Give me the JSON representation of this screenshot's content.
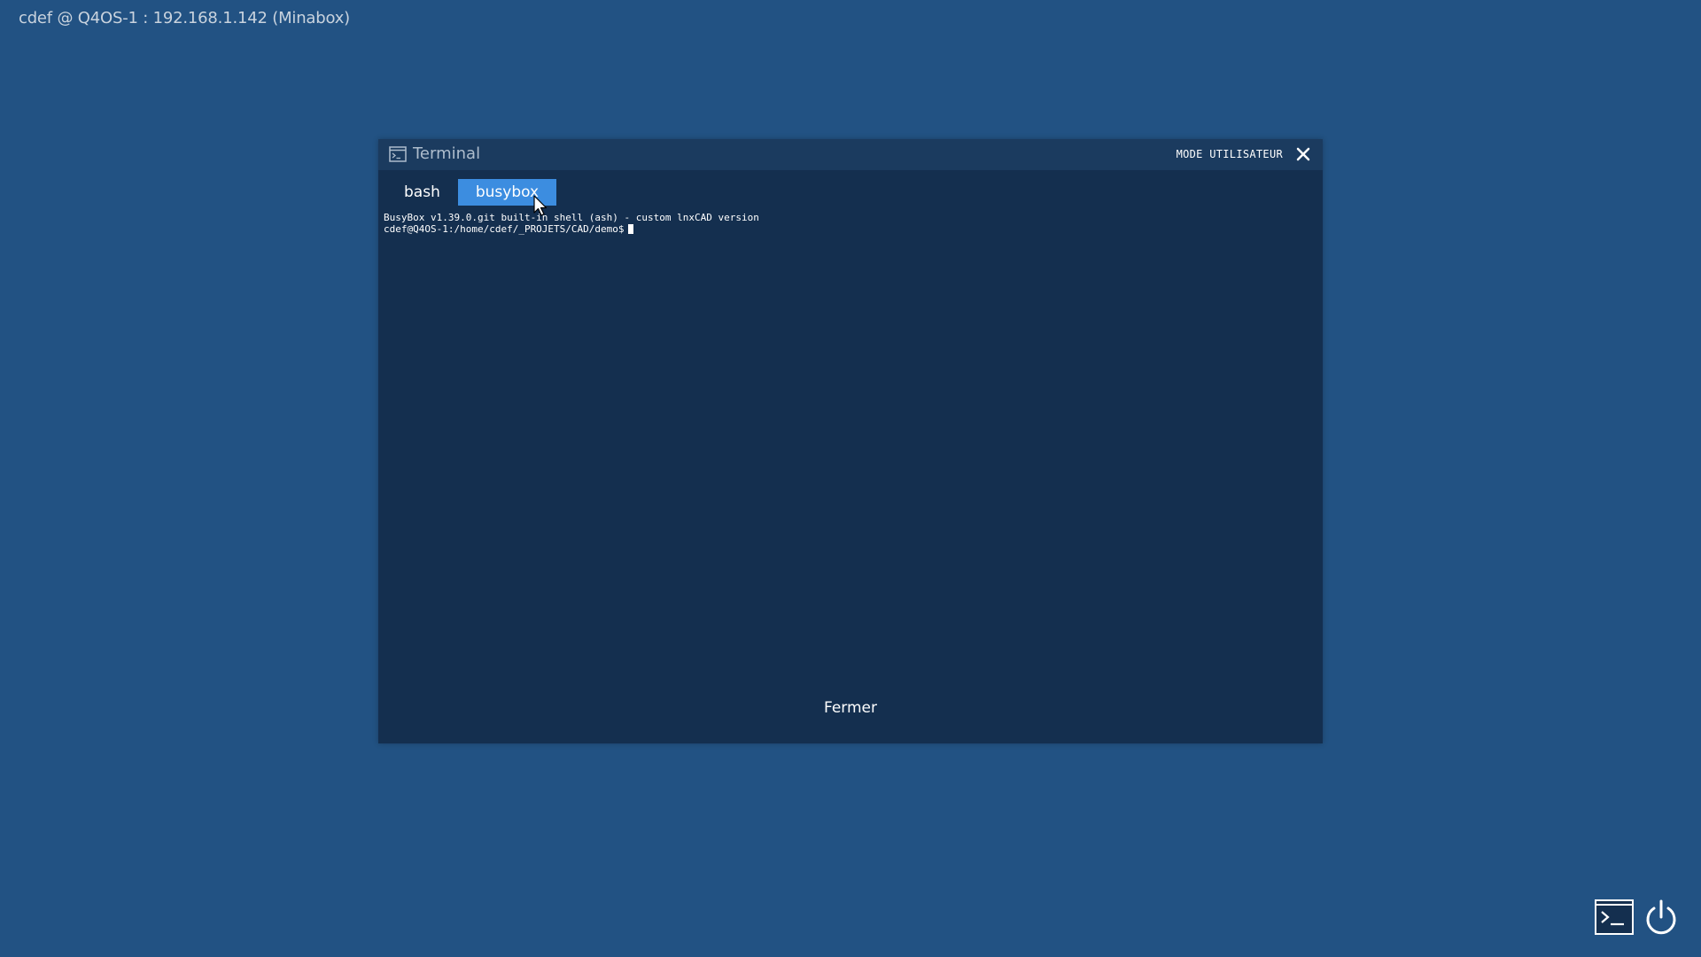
{
  "desktop": {
    "host_label": "cdef @ Q4OS-1 : 192.168.1.142 (Minabox)"
  },
  "window": {
    "title": "Terminal",
    "title_icon": "terminal-icon",
    "mode_label": "MODE UTILISATEUR",
    "close_icon": "close-icon",
    "tabs": [
      {
        "label": "bash",
        "active": false
      },
      {
        "label": "busybox",
        "active": true
      }
    ],
    "terminal_lines": [
      "BusyBox v1.39.0.git built-in shell (ash) - custom lnxCAD version",
      "cdef@Q4OS-1:/home/cdef/_PROJETS/CAD/demo$"
    ],
    "footer_button": "Fermer"
  },
  "dock": {
    "items": [
      {
        "icon": "terminal-icon"
      },
      {
        "icon": "power-icon"
      }
    ]
  },
  "colors": {
    "desktop_bg": "#225283",
    "window_bg": "#142f4f",
    "titlebar_bg": "#1b3b5f",
    "active_tab": "#3c8de0"
  }
}
